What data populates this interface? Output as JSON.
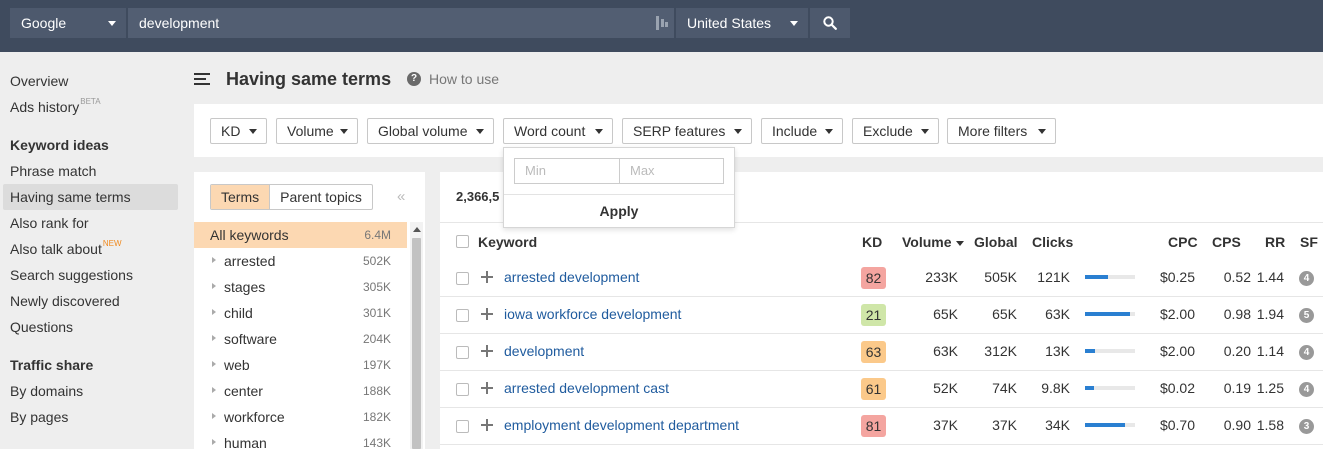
{
  "search": {
    "engine": "Google",
    "query": "development",
    "country": "United States"
  },
  "sidebar": {
    "overview": "Overview",
    "ads_history": "Ads history",
    "ads_history_badge": "BETA",
    "section_keyword_ideas": "Keyword ideas",
    "phrase_match": "Phrase match",
    "having_same_terms": "Having same terms",
    "also_rank_for": "Also rank for",
    "also_talk_about": "Also talk about",
    "also_talk_about_badge": "NEW",
    "search_suggestions": "Search suggestions",
    "newly_discovered": "Newly discovered",
    "questions": "Questions",
    "section_traffic_share": "Traffic share",
    "by_domains": "By domains",
    "by_pages": "By pages"
  },
  "page": {
    "title": "Having same terms",
    "how_to_use": "How to use"
  },
  "filters": {
    "kd": "KD",
    "volume": "Volume",
    "global_volume": "Global volume",
    "word_count": "Word count",
    "serp_features": "SERP features",
    "include": "Include",
    "exclude": "Exclude",
    "more_filters": "More filters"
  },
  "word_count_dropdown": {
    "min_placeholder": "Min",
    "max_placeholder": "Max",
    "apply": "Apply"
  },
  "left_panel": {
    "tab_terms": "Terms",
    "tab_parent_topics": "Parent topics",
    "items": [
      {
        "label": "All keywords",
        "count": "6.4M"
      },
      {
        "label": "arrested",
        "count": "502K"
      },
      {
        "label": "stages",
        "count": "305K"
      },
      {
        "label": "child",
        "count": "301K"
      },
      {
        "label": "software",
        "count": "204K"
      },
      {
        "label": "web",
        "count": "197K"
      },
      {
        "label": "center",
        "count": "188K"
      },
      {
        "label": "workforce",
        "count": "182K"
      },
      {
        "label": "human",
        "count": "143K"
      }
    ]
  },
  "results": {
    "count_label": "2,366,5",
    "columns": {
      "keyword": "Keyword",
      "kd": "KD",
      "volume": "Volume",
      "global": "Global",
      "clicks": "Clicks",
      "cpc": "CPC",
      "cps": "CPS",
      "rr": "RR",
      "sf": "SF"
    },
    "rows": [
      {
        "keyword": "arrested development",
        "kd": "82",
        "kd_color": "#f4a5a0",
        "volume": "233K",
        "global": "505K",
        "clicks": "121K",
        "clicks_fill": 0.45,
        "cpc": "$0.25",
        "cps": "0.52",
        "rr": "1.44",
        "sf": "4"
      },
      {
        "keyword": "iowa workforce development",
        "kd": "21",
        "kd_color": "#cfe6a8",
        "volume": "65K",
        "global": "65K",
        "clicks": "63K",
        "clicks_fill": 0.9,
        "cpc": "$2.00",
        "cps": "0.98",
        "rr": "1.94",
        "sf": "5"
      },
      {
        "keyword": "development",
        "kd": "63",
        "kd_color": "#fbc98a",
        "volume": "63K",
        "global": "312K",
        "clicks": "13K",
        "clicks_fill": 0.2,
        "cpc": "$2.00",
        "cps": "0.20",
        "rr": "1.14",
        "sf": "4"
      },
      {
        "keyword": "arrested development cast",
        "kd": "61",
        "kd_color": "#fbc98a",
        "volume": "52K",
        "global": "74K",
        "clicks": "9.8K",
        "clicks_fill": 0.18,
        "cpc": "$0.02",
        "cps": "0.19",
        "rr": "1.25",
        "sf": "4"
      },
      {
        "keyword": "employment development department",
        "kd": "81",
        "kd_color": "#f4a5a0",
        "volume": "37K",
        "global": "37K",
        "clicks": "34K",
        "clicks_fill": 0.8,
        "cpc": "$0.70",
        "cps": "0.90",
        "rr": "1.58",
        "sf": "3"
      }
    ]
  }
}
